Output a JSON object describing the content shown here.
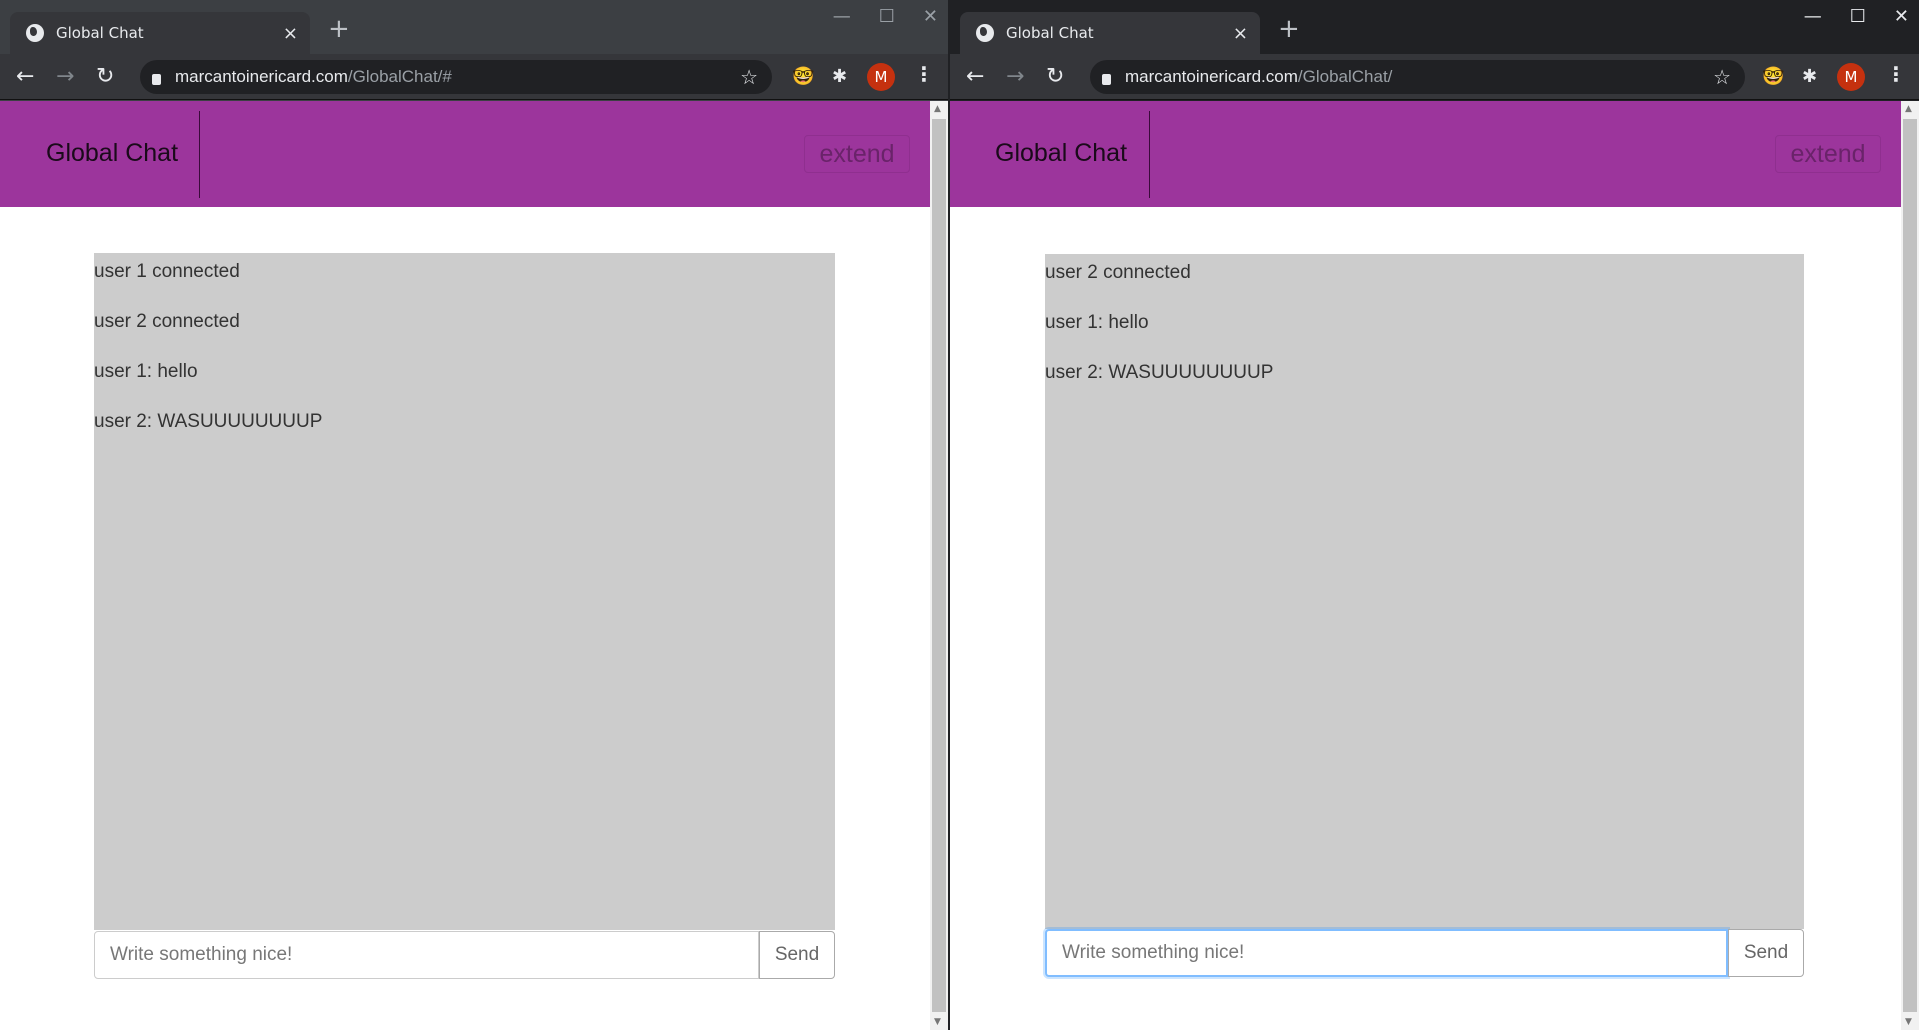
{
  "windows": [
    {
      "tab_title": "Global Chat",
      "url_domain": "marcantoinericard.com",
      "url_path": "/GlobalChat/#",
      "avatar_letter": "M",
      "brand": "Global Chat",
      "extend_label": "extend",
      "messages": [
        "user 1 connected",
        "user 2 connected",
        "user 1: hello",
        "user 2: WASUUUUUUUUP"
      ],
      "input_placeholder": "Write something nice!",
      "send_label": "Send"
    },
    {
      "tab_title": "Global Chat",
      "url_domain": "marcantoinericard.com",
      "url_path": "/GlobalChat/",
      "avatar_letter": "M",
      "brand": "Global Chat",
      "extend_label": "extend",
      "messages": [
        "user 2 connected",
        "user 1: hello",
        "user 2: WASUUUUUUUUP"
      ],
      "input_placeholder": "Write something nice!",
      "send_label": "Send"
    }
  ],
  "icons": {
    "close": "×",
    "new_tab": "+",
    "back": "←",
    "forward": "→",
    "reload": "↻",
    "star": "☆",
    "puzzle": "✱",
    "menu": "⋮",
    "minimize": "—",
    "maximize": "☐",
    "window_close": "✕"
  },
  "colors": {
    "header": "#9c359c",
    "chat_bg": "#cccccc",
    "avatar": "#c5310f"
  }
}
